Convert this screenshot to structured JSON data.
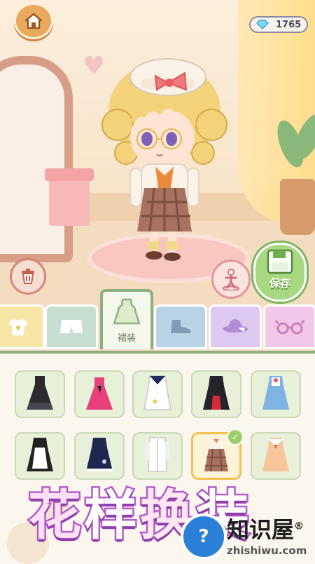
{
  "header": {
    "home_icon": "house-icon",
    "gem_icon": "diamond-icon",
    "gem_count": "1765"
  },
  "actions": {
    "delete_icon": "trash-icon",
    "pose_icon": "pose-figure-icon",
    "save_label": "保存",
    "save_icon": "floppy-disk-icon"
  },
  "tabs": [
    {
      "icon": "shirt-icon",
      "color": "#f6e6a6"
    },
    {
      "icon": "shorts-icon",
      "color": "#c8ded1"
    },
    {
      "icon": "dress-icon",
      "label": "裙装",
      "color": "#f3f7ec",
      "active": true
    },
    {
      "icon": "shoe-icon",
      "color": "#b9d3e6"
    },
    {
      "icon": "hat-icon",
      "color": "#ddc8ef"
    },
    {
      "icon": "glasses-icon",
      "color": "#f1c8ea"
    }
  ],
  "items": [
    {
      "name": "black-gothic-dress"
    },
    {
      "name": "pink-party-dress"
    },
    {
      "name": "sailor-dress"
    },
    {
      "name": "black-red-dress"
    },
    {
      "name": "blue-pinafore-dress"
    },
    {
      "name": "maid-dress"
    },
    {
      "name": "navy-lace-dress"
    },
    {
      "name": "white-coat-dress"
    },
    {
      "name": "plaid-school-dress",
      "selected": true
    },
    {
      "name": "peach-collar-dress"
    }
  ],
  "banner": {
    "chars": [
      "花",
      "样",
      "换",
      "装"
    ]
  },
  "watermark": {
    "title": "知识屋",
    "reg": "®",
    "subtitle": "zhishiwu.com"
  },
  "colors": {
    "accent_green": "#8fae7f",
    "save_green": "#a8d982",
    "banner_purple": "#b55ccd"
  }
}
